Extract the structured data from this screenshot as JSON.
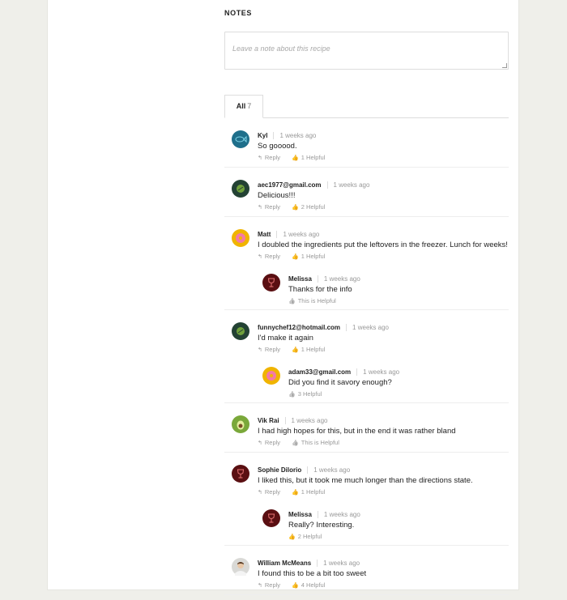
{
  "notes": {
    "title": "NOTES",
    "placeholder": "Leave a note about this recipe"
  },
  "tabs": [
    {
      "label": "All",
      "count": "7"
    }
  ],
  "colors": {
    "helpful_active": "#f2b400",
    "muted": "#999999"
  },
  "comments": [
    {
      "name": "Kyl",
      "time": "1 weeks ago",
      "text": "So gooood.",
      "reply_label": "Reply",
      "helpful": "1 Helpful",
      "helpful_active": true,
      "avatar": "fish-avatar-icon"
    },
    {
      "name": "aec1977@gmail.com",
      "time": "1 weeks ago",
      "text": "Delicious!!!",
      "reply_label": "Reply",
      "helpful": "2 Helpful",
      "helpful_active": true,
      "avatar": "herb-avatar-icon"
    },
    {
      "name": "Matt",
      "time": "1 weeks ago",
      "text": "I doubled the ingredients put the leftovers in the freezer. Lunch for weeks!",
      "reply_label": "Reply",
      "helpful": "1 Helpful",
      "helpful_active": true,
      "avatar": "donut-avatar-icon",
      "replies": [
        {
          "name": "Melissa",
          "time": "1 weeks ago",
          "text": "Thanks for the info",
          "helpful": "This is Helpful",
          "helpful_active": false,
          "avatar": "wine-avatar-icon"
        }
      ]
    },
    {
      "name": "funnychef12@hotmail.com",
      "time": "1 weeks ago",
      "text": "I'd make it again",
      "reply_label": "Reply",
      "helpful": "1 Helpful",
      "helpful_active": true,
      "avatar": "herb-avatar-icon",
      "replies": [
        {
          "name": "adam33@gmail.com",
          "time": "1 weeks ago",
          "text": "Did you find it savory enough?",
          "helpful": "3 Helpful",
          "helpful_active": false,
          "avatar": "donut-avatar-icon"
        }
      ]
    },
    {
      "name": "Vik Rai",
      "time": "1 weeks ago",
      "text": "I had high hopes for this, but in the end it was rather bland",
      "reply_label": "Reply",
      "helpful": "This is Helpful",
      "helpful_active": false,
      "avatar": "avocado-avatar-icon"
    },
    {
      "name": "Sophie Dilorio",
      "time": "1 weeks ago",
      "text": "I liked this, but it took me much longer than the directions state.",
      "reply_label": "Reply",
      "helpful": "1 Helpful",
      "helpful_active": true,
      "avatar": "wine-avatar-icon",
      "replies": [
        {
          "name": "Melissa",
          "time": "1 weeks ago",
          "text": "Really? Interesting.",
          "helpful": "2 Helpful",
          "helpful_active": true,
          "avatar": "wine-avatar-icon"
        }
      ]
    },
    {
      "name": "William McMeans",
      "time": "1 weeks ago",
      "text": "I found this to be a bit too sweet",
      "reply_label": "Reply",
      "helpful": "4 Helpful",
      "helpful_active": true,
      "avatar": "person-photo-avatar"
    }
  ]
}
